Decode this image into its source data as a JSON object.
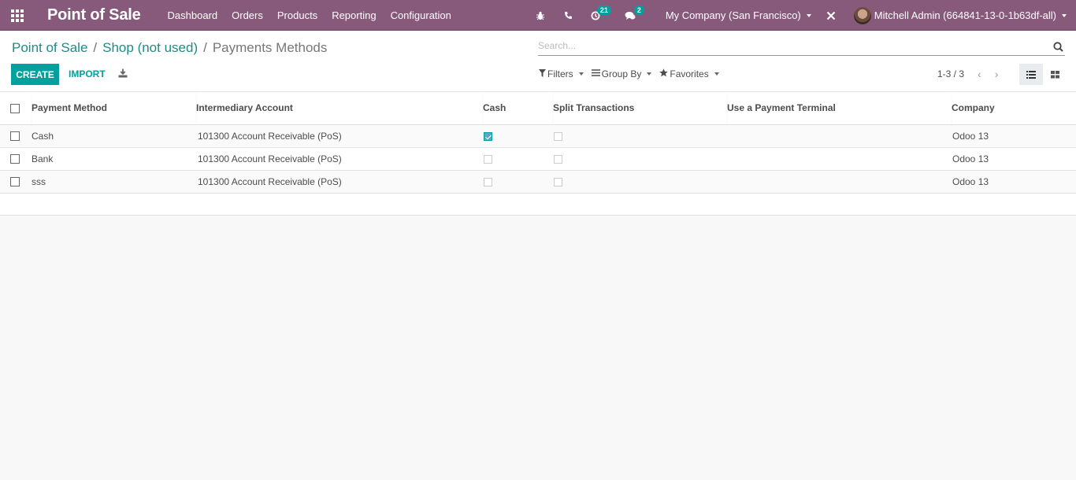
{
  "navbar": {
    "app_title": "Point of Sale",
    "menu": [
      "Dashboard",
      "Orders",
      "Products",
      "Reporting",
      "Configuration"
    ],
    "activity_count": "21",
    "messages_count": "2",
    "company": "My Company (San Francisco)",
    "user": "Mitchell Admin (664841-13-0-1b63df-all)",
    "icons": {
      "apps": "apps-grid-icon",
      "debug": "bug-icon",
      "phone": "phone-icon",
      "activity": "clock-icon",
      "messages": "comments-icon",
      "tools": "tools-icon"
    }
  },
  "breadcrumb": [
    {
      "label": "Point of Sale"
    },
    {
      "label": "Shop (not used)"
    },
    {
      "label": "Payments Methods"
    }
  ],
  "toolbar": {
    "create_label": "CREATE",
    "import_label": "IMPORT"
  },
  "search": {
    "placeholder": "Search...",
    "value": ""
  },
  "facets": {
    "filters": "Filters",
    "group_by": "Group By",
    "favorites": "Favorites"
  },
  "pager": {
    "range": "1-3 / 3"
  },
  "table": {
    "columns": [
      "Payment Method",
      "Intermediary Account",
      "Cash",
      "Split Transactions",
      "Use a Payment Terminal",
      "Company"
    ],
    "rows": [
      {
        "name": "Cash",
        "account": "101300 Account Receivable (PoS)",
        "cash": true,
        "split": false,
        "terminal": "",
        "company": "Odoo 13"
      },
      {
        "name": "Bank",
        "account": "101300 Account Receivable (PoS)",
        "cash": false,
        "split": false,
        "terminal": "",
        "company": "Odoo 13"
      },
      {
        "name": "sss",
        "account": "101300 Account Receivable (PoS)",
        "cash": false,
        "split": false,
        "terminal": "",
        "company": "Odoo 13"
      }
    ]
  },
  "colors": {
    "navbar": "#875a7b",
    "primary": "#00a09d",
    "link": "#1f8b86"
  }
}
